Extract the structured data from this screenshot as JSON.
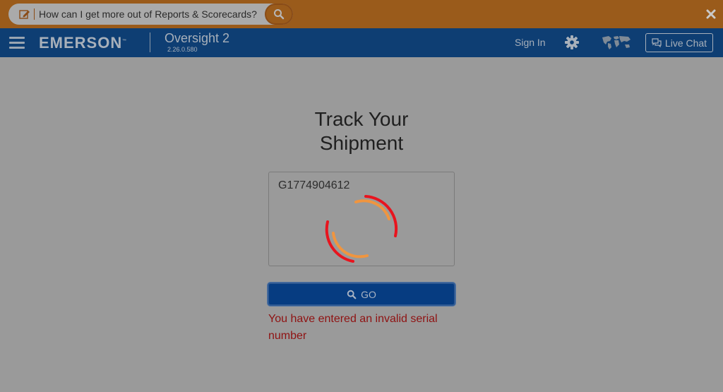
{
  "announcement": {
    "text": "How can I get more out of Reports & Scorecards?",
    "edit_icon": "edit-icon",
    "search_icon": "search-icon",
    "close_icon": "close-icon"
  },
  "header": {
    "menu_icon": "hamburger-icon",
    "brand": "EMERSON",
    "brand_tm": "™",
    "product": "Oversight 2",
    "version": "2.26.0.580",
    "sign_in": "Sign In",
    "settings_icon": "gear-icon",
    "region_icon": "world-map-icon",
    "live_chat": "Live Chat",
    "chat_icon": "chat-icon"
  },
  "main": {
    "title_line1": "Track Your",
    "title_line2": "Shipment",
    "serial_value": "G1774904612",
    "spinner_icon": "loading-spinner-icon",
    "go_label": "GO",
    "error_message": "You have entered an invalid serial number"
  },
  "colors": {
    "topbar": "#9a5b1b",
    "header": "#0e3e73",
    "overlay": "#9a9a9a",
    "go_button": "#063c81",
    "error": "#8f1212",
    "spinner_red": "#e8141e",
    "spinner_orange": "#f0953f"
  }
}
